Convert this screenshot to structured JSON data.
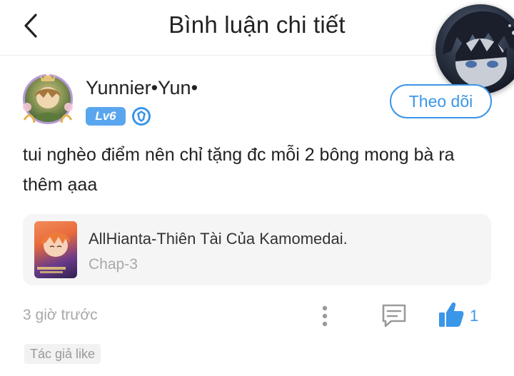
{
  "header": {
    "title": "Bình luận chi tiết",
    "back_icon": "chevron-left-icon"
  },
  "user": {
    "name": "Yunnier•Yun•",
    "level": "Lv6",
    "rank_icon": "shield-icon"
  },
  "follow_button": {
    "label": "Theo dõi"
  },
  "comment": {
    "text": "tui nghèo điểm nên chỉ tặng đc mỗi 2 bông mong bà ra thêm ạaa"
  },
  "story": {
    "title": "AllHianta-Thiên Tài Của Kamomedai.",
    "chapter": "Chap-3"
  },
  "footer": {
    "time": "3 giờ trước",
    "like_count": "1",
    "author_like": "Tác giả like",
    "icons": [
      "more-vertical-icon",
      "comment-icon",
      "thumbs-up-icon"
    ]
  },
  "colors": {
    "accent": "#3a96e8",
    "level_badge": "#5aa6ee",
    "muted_text": "#a8a8a8"
  }
}
